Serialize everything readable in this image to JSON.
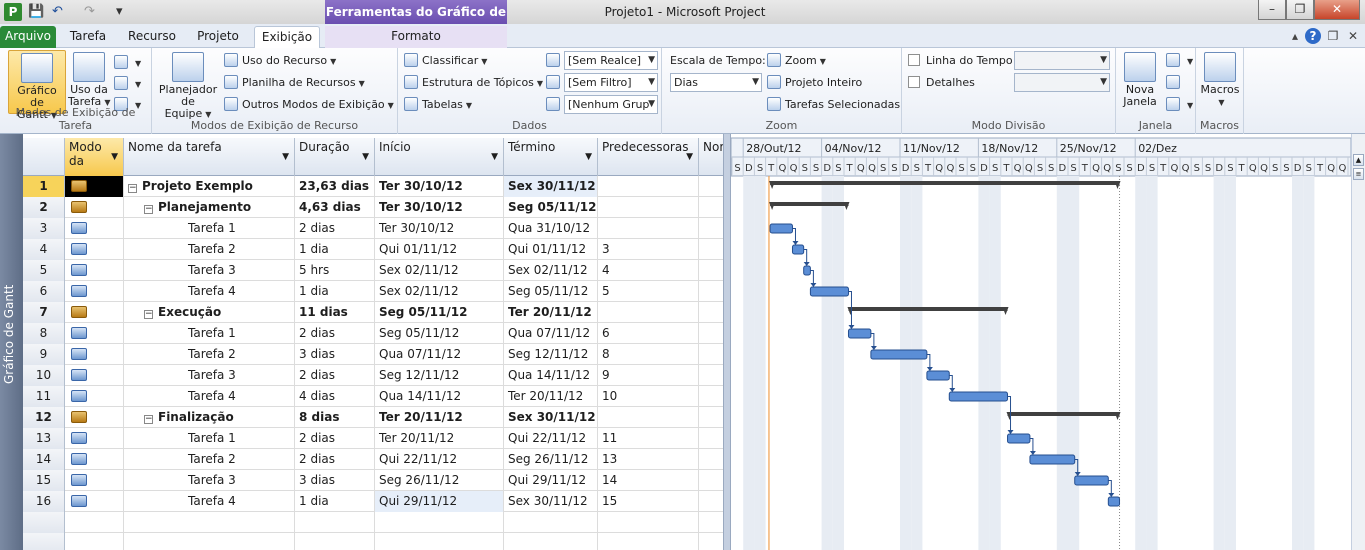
{
  "window": {
    "title": "Projeto1  -  Microsoft Project",
    "context_tab_header": "Ferramentas do Gráfico de Gantt",
    "app_icon_letter": "P",
    "quick_access": {
      "save": "💾",
      "undo": "↶",
      "redo": "↷",
      "customize": "▾"
    },
    "buttons": {
      "minimize": "–",
      "maximize": "❐",
      "close": "✕"
    }
  },
  "tabs": {
    "arquivo": "Arquivo",
    "tarefa": "Tarefa",
    "recurso": "Recurso",
    "projeto": "Projeto",
    "exibicao": "Exibição",
    "formato": "Formato",
    "help": "?",
    "collapse": "▴",
    "restore": "❐",
    "close": "✕"
  },
  "ribbon": {
    "task_views": {
      "label": "Modos de Exibição de Tarefa",
      "gantt_line1": "Gráfico",
      "gantt_line2": "de Gantt",
      "usage_line1": "Uso da",
      "usage_line2": "Tarefa"
    },
    "resource_views": {
      "label": "Modos de Exibição de Recurso",
      "planner_line1": "Planejador",
      "planner_line2": "de Equipe",
      "uso_recurso": "Uso do Recurso",
      "planilha": "Planilha de Recursos",
      "outros": "Outros Modos de Exibição"
    },
    "data": {
      "label": "Dados",
      "classificar": "Classificar",
      "estrutura": "Estrutura de Tópicos",
      "tabelas": "Tabelas",
      "realce": "[Sem Realce]",
      "filtro": "[Sem Filtro]",
      "grupo": "[Nenhum Grup"
    },
    "zoom": {
      "label": "Zoom",
      "escala": "Escala de Tempo:",
      "escala_value": "Dias",
      "zoom": "Zoom",
      "projeto_inteiro": "Projeto Inteiro",
      "tarefas_selecionadas": "Tarefas Selecionadas"
    },
    "split": {
      "label": "Modo Divisão",
      "linha_tempo": "Linha do Tempo",
      "detalhes": "Detalhes"
    },
    "window": {
      "label": "Janela",
      "nova_line1": "Nova",
      "nova_line2": "Janela"
    },
    "macros": {
      "label": "Macros",
      "macros_btn": "Macros"
    }
  },
  "viewbar": {
    "label": "Gráfico de Gantt"
  },
  "grid": {
    "headers": {
      "mode_line1": "Modo",
      "mode_line2": "da",
      "name": "Nome da tarefa",
      "duration": "Duração",
      "start": "Início",
      "finish": "Término",
      "pred": "Predecessoras",
      "extra": "Nom"
    },
    "rows": [
      {
        "id": "1",
        "name": "Projeto Exemplo",
        "duration": "23,63 dias",
        "start": "Ter 30/10/12",
        "finish": "Sex 30/11/12",
        "pred": "",
        "level": 0,
        "summary": true
      },
      {
        "id": "2",
        "name": "Planejamento",
        "duration": "4,63 dias",
        "start": "Ter 30/10/12",
        "finish": "Seg 05/11/12",
        "pred": "",
        "level": 1,
        "summary": true
      },
      {
        "id": "3",
        "name": "Tarefa 1",
        "duration": "2 dias",
        "start": "Ter 30/10/12",
        "finish": "Qua 31/10/12",
        "pred": "",
        "level": 2,
        "summary": false
      },
      {
        "id": "4",
        "name": "Tarefa 2",
        "duration": "1 dia",
        "start": "Qui 01/11/12",
        "finish": "Qui 01/11/12",
        "pred": "3",
        "level": 2,
        "summary": false
      },
      {
        "id": "5",
        "name": "Tarefa 3",
        "duration": "5 hrs",
        "start": "Sex 02/11/12",
        "finish": "Sex 02/11/12",
        "pred": "4",
        "level": 2,
        "summary": false
      },
      {
        "id": "6",
        "name": "Tarefa 4",
        "duration": "1 dia",
        "start": "Sex 02/11/12",
        "finish": "Seg 05/11/12",
        "pred": "5",
        "level": 2,
        "summary": false
      },
      {
        "id": "7",
        "name": "Execução",
        "duration": "11 dias",
        "start": "Seg 05/11/12",
        "finish": "Ter 20/11/12",
        "pred": "",
        "level": 1,
        "summary": true
      },
      {
        "id": "8",
        "name": "Tarefa 1",
        "duration": "2 dias",
        "start": "Seg 05/11/12",
        "finish": "Qua 07/11/12",
        "pred": "6",
        "level": 2,
        "summary": false
      },
      {
        "id": "9",
        "name": "Tarefa 2",
        "duration": "3 dias",
        "start": "Qua 07/11/12",
        "finish": "Seg 12/11/12",
        "pred": "8",
        "level": 2,
        "summary": false
      },
      {
        "id": "10",
        "name": "Tarefa 3",
        "duration": "2 dias",
        "start": "Seg 12/11/12",
        "finish": "Qua 14/11/12",
        "pred": "9",
        "level": 2,
        "summary": false
      },
      {
        "id": "11",
        "name": "Tarefa 4",
        "duration": "4 dias",
        "start": "Qua 14/11/12",
        "finish": "Ter 20/11/12",
        "pred": "10",
        "level": 2,
        "summary": false
      },
      {
        "id": "12",
        "name": "Finalização",
        "duration": "8 dias",
        "start": "Ter 20/11/12",
        "finish": "Sex 30/11/12",
        "pred": "",
        "level": 1,
        "summary": true
      },
      {
        "id": "13",
        "name": "Tarefa 1",
        "duration": "2 dias",
        "start": "Ter 20/11/12",
        "finish": "Qui 22/11/12",
        "pred": "11",
        "level": 2,
        "summary": false
      },
      {
        "id": "14",
        "name": "Tarefa 2",
        "duration": "2 dias",
        "start": "Qui 22/11/12",
        "finish": "Seg 26/11/12",
        "pred": "13",
        "level": 2,
        "summary": false
      },
      {
        "id": "15",
        "name": "Tarefa 3",
        "duration": "3 dias",
        "start": "Seg 26/11/12",
        "finish": "Qui 29/11/12",
        "pred": "14",
        "level": 2,
        "summary": false
      },
      {
        "id": "16",
        "name": "Tarefa 4",
        "duration": "1 dia",
        "start": "Qui 29/11/12",
        "finish": "Sex 30/11/12",
        "pred": "15",
        "level": 2,
        "summary": false
      }
    ]
  },
  "gantt": {
    "weeks": [
      "28/Out/12",
      "04/Nov/12",
      "11/Nov/12",
      "18/Nov/12",
      "25/Nov/12",
      "02/Dez"
    ],
    "day_letters": [
      "S",
      "D",
      "S",
      "T",
      "Q",
      "Q",
      "S",
      "S",
      "D",
      "S",
      "T",
      "Q",
      "Q",
      "S",
      "S",
      "D",
      "S",
      "T",
      "Q",
      "Q",
      "S",
      "S",
      "D",
      "S",
      "T",
      "Q",
      "Q",
      "S",
      "S",
      "D",
      "S",
      "T",
      "Q",
      "Q",
      "S",
      "S",
      "D",
      "S",
      "T",
      "Q",
      "Q",
      "S",
      "S",
      "D",
      "S",
      "T",
      "Q",
      "Q",
      "S",
      "S",
      "D",
      "S",
      "T",
      "Q",
      "Q",
      "S"
    ],
    "today_day": 3.3,
    "bars": [
      {
        "row": 0,
        "type": "summary",
        "start": 3.4,
        "end": 34.6
      },
      {
        "row": 1,
        "type": "summary",
        "start": 3.4,
        "end": 10.4
      },
      {
        "row": 2,
        "type": "task",
        "start": 3.4,
        "end": 5.4
      },
      {
        "row": 3,
        "type": "task",
        "start": 5.4,
        "end": 6.4
      },
      {
        "row": 4,
        "type": "task",
        "start": 6.4,
        "end": 7.0
      },
      {
        "row": 5,
        "type": "task",
        "start": 7.0,
        "end": 10.4
      },
      {
        "row": 6,
        "type": "summary",
        "start": 10.4,
        "end": 24.6
      },
      {
        "row": 7,
        "type": "task",
        "start": 10.4,
        "end": 12.4
      },
      {
        "row": 8,
        "type": "task",
        "start": 12.4,
        "end": 17.4
      },
      {
        "row": 9,
        "type": "task",
        "start": 17.4,
        "end": 19.4
      },
      {
        "row": 10,
        "type": "task",
        "start": 19.4,
        "end": 24.6
      },
      {
        "row": 11,
        "type": "summary",
        "start": 24.6,
        "end": 34.6
      },
      {
        "row": 12,
        "type": "task",
        "start": 24.6,
        "end": 26.6
      },
      {
        "row": 13,
        "type": "task",
        "start": 26.6,
        "end": 30.6
      },
      {
        "row": 14,
        "type": "task",
        "start": 30.6,
        "end": 33.6
      },
      {
        "row": 15,
        "type": "task",
        "start": 33.6,
        "end": 34.6
      }
    ],
    "colors": {
      "task": "#5b8ed6",
      "task_border": "#264f8f",
      "summary": "#404040",
      "today": "#f0a050",
      "weekend": "#e7ecf3"
    }
  }
}
